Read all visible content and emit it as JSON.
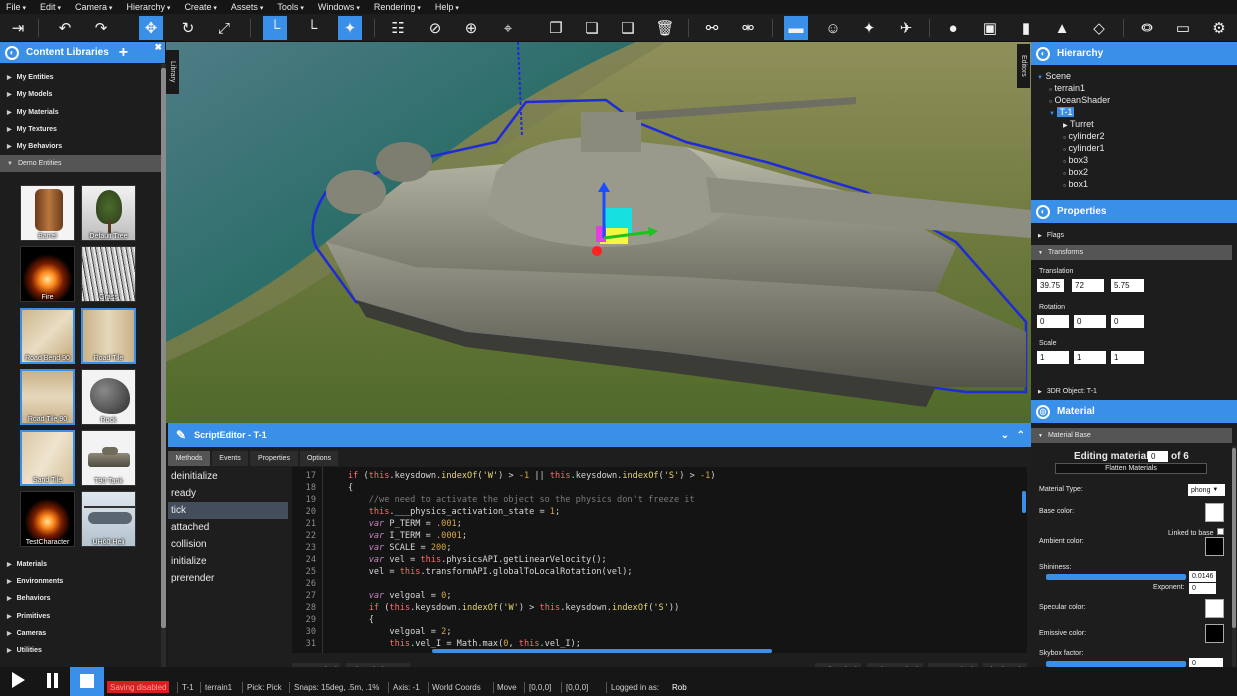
{
  "menu": [
    "File",
    "Edit",
    "Camera",
    "Hierarchy",
    "Create",
    "Assets",
    "Tools",
    "Windows",
    "Rendering",
    "Help"
  ],
  "toolbar": {
    "icons": [
      "exit-icon",
      "undo-icon",
      "redo-icon",
      "move-icon",
      "rotate-icon",
      "scale-icon",
      "snap-icon",
      "local-axis-icon",
      "star-icon",
      "grid-icon",
      "no-icon",
      "target-icon",
      "copy-icon",
      "paste-icon",
      "duplicate-icon",
      "delete-icon",
      "link-icon",
      "unlink-icon",
      "vehicle-icon",
      "person-icon",
      "light-icon",
      "plane-icon",
      "sphere-icon",
      "cube-icon",
      "cylinder-icon",
      "cone-icon",
      "grid-plane-icon",
      "physics-icon",
      "monitor-icon",
      "settings-icon"
    ],
    "active_color": "#3a8fe8"
  },
  "left": {
    "title": "Content Libraries",
    "top_items": [
      "My Entities",
      "My Models",
      "My Materials",
      "My Textures",
      "My Behaviors"
    ],
    "open_item": "Demo Entities",
    "thumbs": [
      {
        "label": "Barrel"
      },
      {
        "label": "Default Tree"
      },
      {
        "label": "Fire"
      },
      {
        "label": "Grass"
      },
      {
        "label": "Road Bend 90"
      },
      {
        "label": "Road Tile"
      },
      {
        "label": "Road Tile 90"
      },
      {
        "label": "Rock"
      },
      {
        "label": "Sand Tile"
      },
      {
        "label": "T90 Tank"
      },
      {
        "label": "TestCharacter"
      },
      {
        "label": "UH60 Heli"
      }
    ],
    "bottom_items": [
      "Materials",
      "Environments",
      "Behaviors",
      "Primitives",
      "Cameras",
      "Utilities"
    ],
    "tab_library": "Library"
  },
  "viewport": {
    "tab_editors": "Editors"
  },
  "script": {
    "title": "ScriptEditor - T-1",
    "tabs": [
      "Methods",
      "Events",
      "Properties",
      "Options"
    ],
    "methods": [
      "deinitialize",
      "ready",
      "tick",
      "attached",
      "collision",
      "initialize",
      "prerender"
    ],
    "selected_method": "tick",
    "line_numbers": [
      "17",
      "18",
      "19",
      "20",
      "21",
      "22",
      "23",
      "24",
      "25",
      "26",
      "27",
      "28",
      "29",
      "30",
      "31"
    ],
    "buttons_left": [
      "Save Method",
      "Discard Changes"
    ],
    "buttons_right": [
      "Call Method",
      "Delete Method",
      "New Method",
      "Check Code"
    ]
  },
  "hierarchy": {
    "title": "Hierarchy",
    "root": "Scene",
    "items": [
      "terrain1",
      "OceanShader",
      "T-1",
      "Turret",
      "cylinder2",
      "cylinder1",
      "box3",
      "box2",
      "box1"
    ]
  },
  "properties": {
    "title": "Properties",
    "flags": "Flags",
    "transforms": "Transforms",
    "translation_label": "Translation",
    "translation": [
      "39.75",
      "72",
      "5.75"
    ],
    "rotation_label": "Rotation",
    "rotation": [
      "0",
      "0",
      "0"
    ],
    "scale_label": "Scale",
    "scale": [
      "1",
      "1",
      "1"
    ],
    "object": "3DR Object: T-1"
  },
  "material": {
    "title": "Material",
    "base": "Material Base",
    "editing_prefix": "Editing material",
    "editing_index": "0",
    "editing_suffix": "of 6",
    "flatten": "Flatten Materials",
    "type_label": "Material Type:",
    "type_value": "phong",
    "base_color": "Base color:",
    "linked": "Linked to base",
    "ambient": "Ambient color:",
    "shininess": "Shininess:",
    "shininess_value": "0.0146",
    "exponent_label": "Exponent:",
    "exponent_value": "0",
    "specular": "Specular color:",
    "emissive": "Emissive color:",
    "skybox": "Skybox factor:",
    "skybox_value": "0"
  },
  "status": {
    "saving": "Saving disabled",
    "selected": "T-1",
    "terrain": "terrain1",
    "pick": "Pick: Pick",
    "snaps": "Snaps: 15deg, .5m, .1%",
    "axis": "Axis: -1",
    "coords": "World Coords",
    "mode": "Move",
    "pos1": "[0,0,0]",
    "pos2": "[0,0,0]",
    "logged": "Logged in as:",
    "user": "Rob"
  }
}
